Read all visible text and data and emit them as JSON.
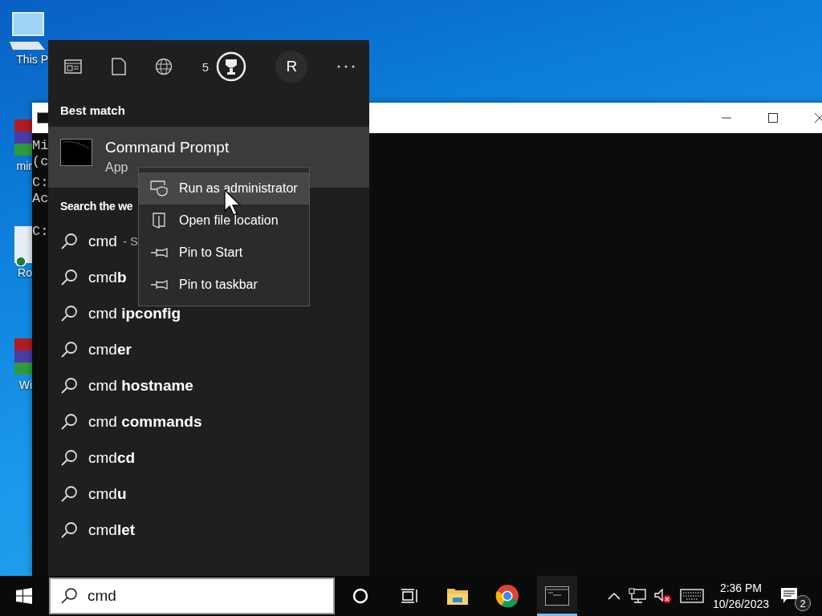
{
  "desktop": {
    "icons": [
      {
        "kind": "computer",
        "label": "This P"
      },
      {
        "kind": "archive",
        "label": "mir"
      },
      {
        "kind": "document",
        "label": "Ro"
      },
      {
        "kind": "archive",
        "label": "Wi"
      }
    ]
  },
  "console_window": {
    "blocks": [
      [
        "Mi",
        "(c"
      ],
      [
        "C:",
        "Ac"
      ],
      [
        "C:"
      ]
    ]
  },
  "start_menu": {
    "toolbar": {
      "points": "5",
      "avatar": "R"
    },
    "best_match": {
      "heading": "Best match",
      "title": "Command Prompt",
      "subtitle": "App",
      "selected": true
    },
    "web": {
      "heading": "Search the we",
      "results": [
        {
          "text": "cmd",
          "hint": "- S"
        },
        {
          "text": "cmd**b**"
        },
        {
          "text": "cmd **ipconfig**"
        },
        {
          "text": "cmd**er**"
        },
        {
          "text": "cmd **hostname**"
        },
        {
          "text": "cmd **commands**"
        },
        {
          "text": "cmd**cd**"
        },
        {
          "text": "cmd**u**"
        },
        {
          "text": "cmd**let**"
        }
      ]
    }
  },
  "context_menu": {
    "items": [
      {
        "kind": "shield",
        "label": "Run as administrator",
        "selected": true
      },
      {
        "kind": "folder",
        "label": "Open file location",
        "selected": false
      },
      {
        "kind": "pin",
        "label": "Pin to Start",
        "selected": false
      },
      {
        "kind": "pin",
        "label": "Pin to taskbar",
        "selected": false
      }
    ]
  },
  "taskbar": {
    "search": {
      "value": "cmd"
    },
    "apps": [
      {
        "kind": "explorer",
        "active": false
      },
      {
        "kind": "chrome",
        "active": false
      },
      {
        "kind": "console",
        "active": true
      }
    ],
    "clock": {
      "time": "2:36 PM",
      "date": "10/26/2023"
    },
    "notifications": {
      "count": "2"
    }
  }
}
